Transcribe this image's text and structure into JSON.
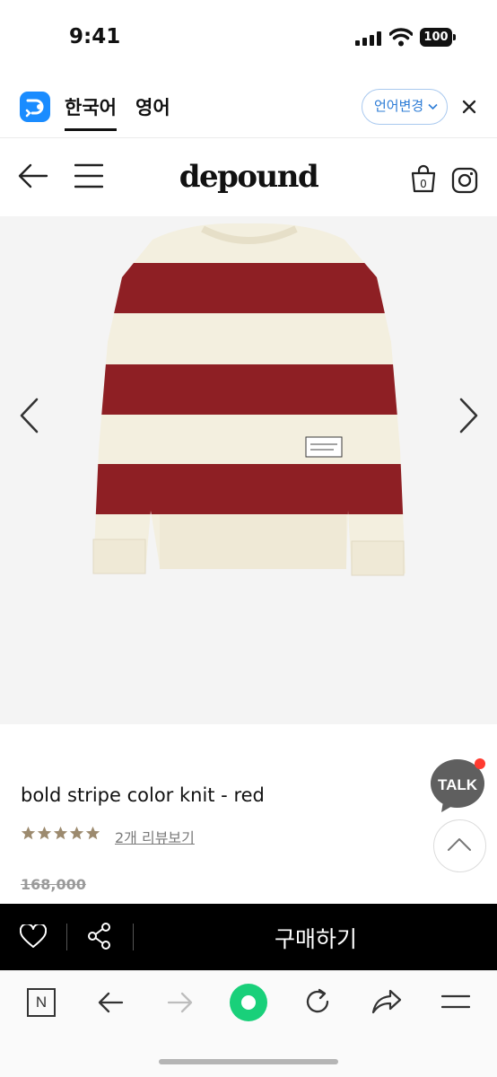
{
  "status_bar": {
    "time": "9:41",
    "battery": "100"
  },
  "translate_bar": {
    "tab_korean": "한국어",
    "tab_english": "영어",
    "change_language": "언어변경"
  },
  "header": {
    "brand": "depound",
    "cart_count": "0"
  },
  "product": {
    "title": "bold stripe color knit - red",
    "rating_stars": 5,
    "review_link": "2개 리뷰보기",
    "original_price": "168,000",
    "colors": {
      "stripe_red": "#8e1f24",
      "cream": "#f3efdf",
      "star": "#9c8a6e"
    }
  },
  "talk_button": {
    "label": "TALK"
  },
  "buy_bar": {
    "buy_label": "구매하기"
  },
  "browser_toolbar": {
    "naver_label": "N"
  }
}
